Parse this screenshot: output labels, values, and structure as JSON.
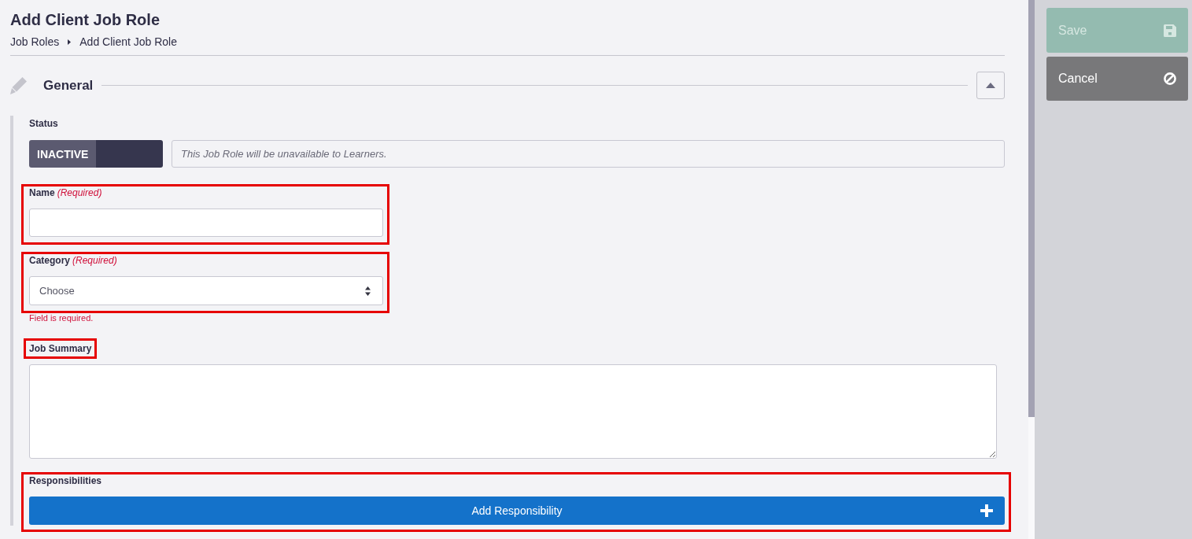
{
  "header": {
    "title": "Add Client Job Role",
    "breadcrumb": [
      "Job Roles",
      "Add Client Job Role"
    ]
  },
  "section": {
    "title": "General",
    "expanded": true
  },
  "status": {
    "label": "Status",
    "toggle_label": "INACTIVE",
    "on": false,
    "note": "This Job Role will be unavailable to Learners."
  },
  "fields": [
    {
      "kind": "text",
      "label": "Name",
      "required_note": "(Required)",
      "highlighted": true,
      "label_highlighted": false
    },
    {
      "kind": "select",
      "label": "Category",
      "required_note": "(Required)",
      "value": "Choose",
      "error": "Field is required.",
      "highlighted": true,
      "label_highlighted": false
    },
    {
      "kind": "textarea",
      "label": "Job Summary",
      "highlighted": false,
      "label_highlighted": true
    },
    {
      "kind": "button_list",
      "label": "Responsibilities",
      "button": "Add Responsibility",
      "highlighted": true,
      "label_highlighted": false
    }
  ],
  "actions": [
    {
      "kind": "save",
      "label": "Save",
      "disabled": true
    },
    {
      "kind": "cancel",
      "label": "Cancel",
      "disabled": false
    }
  ]
}
